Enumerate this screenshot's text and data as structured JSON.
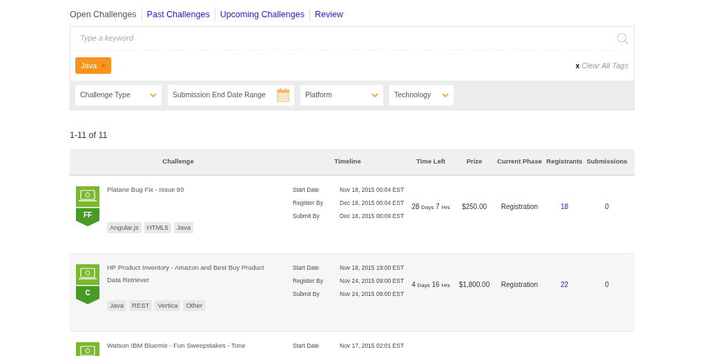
{
  "tabs": [
    {
      "label": "Open Challenges",
      "selected": true
    },
    {
      "label": "Past Challenges",
      "selected": false
    },
    {
      "label": "Upcoming Challenges",
      "selected": false
    },
    {
      "label": "Review",
      "selected": false
    }
  ],
  "search": {
    "placeholder": "Type a keyword"
  },
  "tags": [
    {
      "label": "Java",
      "remove": "×"
    }
  ],
  "clear_tags": {
    "icon": "x",
    "label": "Clear All Tags"
  },
  "filters": [
    {
      "label": "Challenge Type",
      "kind": "dropdown"
    },
    {
      "label": "Submission End Date Range",
      "kind": "date"
    },
    {
      "label": "Platform",
      "kind": "dropdown"
    },
    {
      "label": "Technology",
      "kind": "dropdown"
    }
  ],
  "result_count": "1-11 of 11",
  "table": {
    "columns": [
      "Challenge",
      "Timeline",
      "Time Left",
      "Prize",
      "Current Phase",
      "Registrants",
      "Submissions"
    ],
    "rows": [
      {
        "badge": "FF",
        "title": "Platane Bug Fix - Issue 80",
        "tags": [
          "Angular.js",
          "HTML5",
          "Java"
        ],
        "timeline": [
          {
            "label": "Start Date",
            "date": "Nov 18, 2015 00:04 EST"
          },
          {
            "label": "Register By",
            "date": "Dec 18, 2015 00:04 EST"
          },
          {
            "label": "Submit By",
            "date": "Dec 18, 2015 00:09 EST"
          }
        ],
        "time_left": {
          "days": "28",
          "days_unit": "Days",
          "hours": "7",
          "hours_unit": "Hrs"
        },
        "prize": "$250.00",
        "phase": "Registration",
        "registrants": "18",
        "submissions": "0"
      },
      {
        "badge": "C",
        "title": "HP Product Inventory - Amazon and Best Buy Product Data Retriever",
        "tags": [
          "Java",
          "REST",
          "Vertica",
          "Other"
        ],
        "timeline": [
          {
            "label": "Start Date",
            "date": "Nov 18, 2015 19:00 EST"
          },
          {
            "label": "Register By",
            "date": "Nov 24, 2015 09:00 EST"
          },
          {
            "label": "Submit By",
            "date": "Nov 24, 2015 09:00 EST"
          }
        ],
        "time_left": {
          "days": "4",
          "days_unit": "Days",
          "hours": "16",
          "hours_unit": "Hrs"
        },
        "prize": "$1,800.00",
        "phase": "Registration",
        "registrants": "22",
        "submissions": "0"
      },
      {
        "title": "Watson IBM Bluemix - Fun Sweepstakes - Tone",
        "timeline": [
          {
            "label": "Start Date",
            "date": "Nov 17, 2015 02:01 EST"
          }
        ]
      }
    ]
  }
}
